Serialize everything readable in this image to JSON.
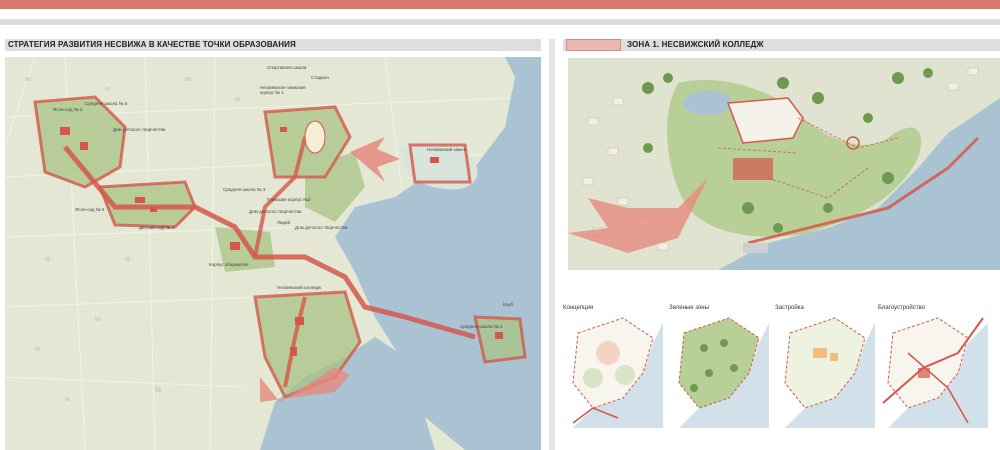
{
  "header": {
    "left_title": "СТРАТЕГИЯ РАЗВИТИЯ НЕСВИЖА В КАЧЕСТВЕ ТОЧКИ ОБРАЗОВАНИЯ",
    "right_title": "ЗОНА 1. НЕСВИЖСКИЙ КОЛЛЕДЖ"
  },
  "colors": {
    "accent": "#d97a6c",
    "route": "#d4574a",
    "water": "#a9c3d3",
    "land": "#e7e9d6",
    "green": "#9fbf7a",
    "header_bg": "#dedede"
  },
  "map_labels": {
    "sport_school": "Спортивная школа",
    "stadium": "Стадион",
    "gymnasium_1": "Несвижская гимназия корпус № 1",
    "school_5": "Средняя школа № 5",
    "kindergarten_5": "Ясли-сад № 5",
    "kindergarten_2": "Ясли-сад № 2",
    "creativity_house": "Дом детского творчества",
    "kindergarten_4": "Детский сад № 4",
    "school_3": "Средняя школа № 3",
    "gymnasium_2": "Гимназия корпус №2",
    "creativity_house_2": "Дом детского творчества",
    "lyceum": "Лицей",
    "house_of_culture": "Дом детского творчества",
    "college": "Несвижский колледж",
    "castle": "Несвижский замок",
    "school_4": "Средняя школа № 4",
    "club": "Клуб",
    "dormitory": "Корпус общежития"
  },
  "diagrams": [
    {
      "title": "Концепция"
    },
    {
      "title": "Зеленые зоны"
    },
    {
      "title": "Застройка"
    },
    {
      "title": "Благоустройство"
    }
  ]
}
